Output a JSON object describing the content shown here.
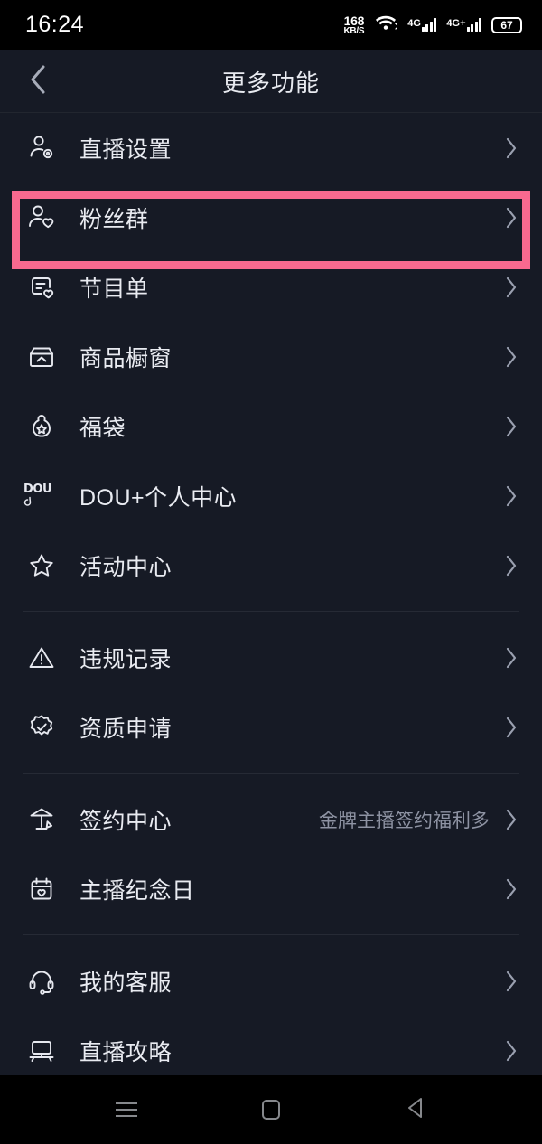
{
  "statusbar": {
    "time": "16:24",
    "net_speed_value": "168",
    "net_speed_unit": "KB/S",
    "wifi_icon": "wifi-icon",
    "sim1_label": "4G",
    "sim2_label": "4G+",
    "battery_level": "67"
  },
  "header": {
    "title": "更多功能",
    "back_icon": "chevron-left-icon"
  },
  "highlight": {
    "color": "#f8698f",
    "target": "粉丝群"
  },
  "groups": [
    {
      "items": [
        {
          "icon": "person-gear-icon",
          "label": "直播设置",
          "value": "",
          "chevron": "chevron-right-icon"
        },
        {
          "icon": "person-heart-icon",
          "label": "粉丝群",
          "value": "",
          "chevron": "chevron-right-icon"
        },
        {
          "icon": "program-list-heart-icon",
          "label": "节目单",
          "value": "",
          "chevron": "chevron-right-icon"
        },
        {
          "icon": "storefront-icon",
          "label": "商品橱窗",
          "value": "",
          "chevron": "chevron-right-icon"
        },
        {
          "icon": "lucky-bag-star-icon",
          "label": "福袋",
          "value": "",
          "chevron": "chevron-right-icon"
        },
        {
          "icon": "dou-plus-icon",
          "label": "DOU+个人中心",
          "value": "",
          "chevron": "chevron-right-icon"
        },
        {
          "icon": "star-icon",
          "label": "活动中心",
          "value": "",
          "chevron": "chevron-right-icon"
        }
      ]
    },
    {
      "items": [
        {
          "icon": "warning-triangle-icon",
          "label": "违规记录",
          "value": "",
          "chevron": "chevron-right-icon"
        },
        {
          "icon": "verified-badge-icon",
          "label": "资质申请",
          "value": "",
          "chevron": "chevron-right-icon"
        }
      ]
    },
    {
      "items": [
        {
          "icon": "contract-pen-icon",
          "label": "签约中心",
          "value": "金牌主播签约福利多",
          "chevron": "chevron-right-icon"
        },
        {
          "icon": "calendar-heart-icon",
          "label": "主播纪念日",
          "value": "",
          "chevron": "chevron-right-icon"
        }
      ]
    },
    {
      "items": [
        {
          "icon": "headset-icon",
          "label": "我的客服",
          "value": "",
          "chevron": "chevron-right-icon"
        },
        {
          "icon": "easel-board-icon",
          "label": "直播攻略",
          "value": "",
          "chevron": "chevron-right-icon"
        }
      ]
    }
  ],
  "navbar": {
    "menu_icon": "menu-icon",
    "home_icon": "home-square-icon",
    "back_icon": "back-triangle-icon"
  }
}
